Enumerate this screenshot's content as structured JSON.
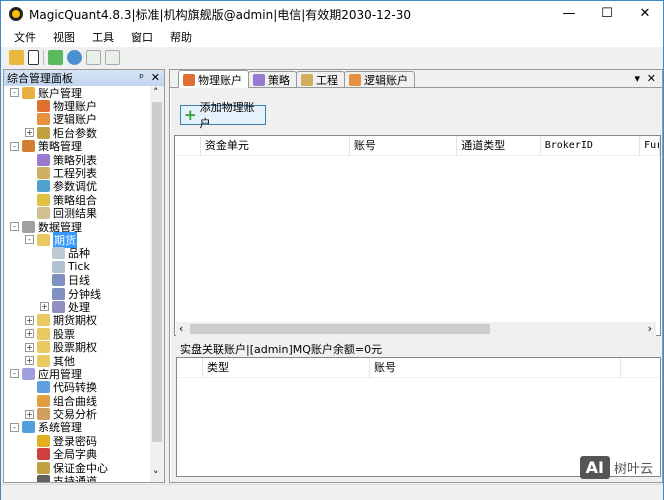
{
  "window": {
    "title": "MagicQuant4.8.3|标准|机构旗舰版@admin|电信|有效期2030-12-30",
    "minimize": "—",
    "maximize": "☐",
    "close": "✕"
  },
  "menu": [
    "文件",
    "视图",
    "工具",
    "窗口",
    "帮助"
  ],
  "toolbar": [
    "open-folder",
    "new-file",
    "connect",
    "info",
    "import",
    "export"
  ],
  "left_panel": {
    "title": "综合管理面板",
    "pin": "ᵖ",
    "close": "✕",
    "tree": [
      {
        "label": "账户管理",
        "level": 0,
        "exp": "-",
        "icon": "lock",
        "color": "#e8b040"
      },
      {
        "label": "物理账户",
        "level": 1,
        "icon": "link",
        "color": "#e07030"
      },
      {
        "label": "逻辑账户",
        "level": 1,
        "icon": "users",
        "color": "#e89040"
      },
      {
        "label": "柜台参数",
        "level": 1,
        "exp": "+",
        "icon": "gear",
        "color": "#c0a040"
      },
      {
        "label": "策略管理",
        "level": 0,
        "exp": "-",
        "icon": "grid",
        "color": "#d08030"
      },
      {
        "label": "策略列表",
        "level": 1,
        "icon": "strategy",
        "color": "#9a7ad0"
      },
      {
        "label": "工程列表",
        "level": 1,
        "icon": "project",
        "color": "#d0b060"
      },
      {
        "label": "参数调优",
        "level": 1,
        "icon": "magnifier",
        "color": "#50a0d0"
      },
      {
        "label": "策略组合",
        "level": 1,
        "icon": "combo",
        "color": "#e0c040"
      },
      {
        "label": "回测结果",
        "level": 1,
        "icon": "result",
        "color": "#d0c090"
      },
      {
        "label": "数据管理",
        "level": 0,
        "exp": "-",
        "icon": "database",
        "color": "#a0a0a0"
      },
      {
        "label": "期货",
        "level": 1,
        "exp": "-",
        "icon": "folder",
        "color": "#e8c860",
        "selected": true
      },
      {
        "label": "品种",
        "level": 2,
        "icon": "item",
        "color": "#c0c8d0"
      },
      {
        "label": "Tick",
        "level": 2,
        "icon": "tick",
        "color": "#b0c0d0"
      },
      {
        "label": "日线",
        "level": 2,
        "icon": "bars",
        "color": "#8090c0"
      },
      {
        "label": "分钟线",
        "level": 2,
        "icon": "bars",
        "color": "#8090c0"
      },
      {
        "label": "处理",
        "level": 2,
        "exp": "+",
        "icon": "process",
        "color": "#9090c0"
      },
      {
        "label": "期货期权",
        "level": 1,
        "exp": "+",
        "icon": "folder",
        "color": "#e8c860"
      },
      {
        "label": "股票",
        "level": 1,
        "exp": "+",
        "icon": "folder",
        "color": "#e8c860"
      },
      {
        "label": "股票期权",
        "level": 1,
        "exp": "+",
        "icon": "folder",
        "color": "#e8c860"
      },
      {
        "label": "其他",
        "level": 1,
        "exp": "+",
        "icon": "folder",
        "color": "#e8c860"
      },
      {
        "label": "应用管理",
        "level": 0,
        "exp": "-",
        "icon": "apps",
        "color": "#a0a0e0"
      },
      {
        "label": "代码转换",
        "level": 1,
        "icon": "convert",
        "color": "#60a0e0"
      },
      {
        "label": "组合曲线",
        "level": 1,
        "icon": "curve",
        "color": "#e0a040"
      },
      {
        "label": "交易分析",
        "level": 1,
        "exp": "+",
        "icon": "analysis",
        "color": "#d0a060"
      },
      {
        "label": "系统管理",
        "level": 0,
        "exp": "-",
        "icon": "system",
        "color": "#50a0e0"
      },
      {
        "label": "登录密码",
        "level": 1,
        "icon": "key",
        "color": "#e0b020"
      },
      {
        "label": "全局字典",
        "level": 1,
        "icon": "dictionary",
        "color": "#d04040"
      },
      {
        "label": "保证金中心",
        "level": 1,
        "icon": "money",
        "color": "#c0a040"
      },
      {
        "label": "支持通道",
        "level": 1,
        "icon": "channel",
        "color": "#606060"
      }
    ]
  },
  "tabs": [
    {
      "label": "物理账户",
      "active": true,
      "color": "#e07030"
    },
    {
      "label": "策略",
      "color": "#9a7ad0"
    },
    {
      "label": "工程",
      "color": "#d0b060"
    },
    {
      "label": "逻辑账户",
      "color": "#e89040"
    }
  ],
  "tab_menu": "▾",
  "tab_close": "✕",
  "add_button": "添加物理账户",
  "grid1": {
    "columns": [
      "",
      "资金单元",
      "账号",
      "通道类型",
      "BrokerID",
      "Fur"
    ]
  },
  "scroll_left": "‹",
  "scroll_right": "›",
  "linked_label": "实盘关联账户|[admin]MQ账户余额=0元",
  "grid2": {
    "columns": [
      "",
      "类型",
      "账号",
      ""
    ]
  },
  "watermark": {
    "logo": "AI",
    "text": "树叶云"
  }
}
